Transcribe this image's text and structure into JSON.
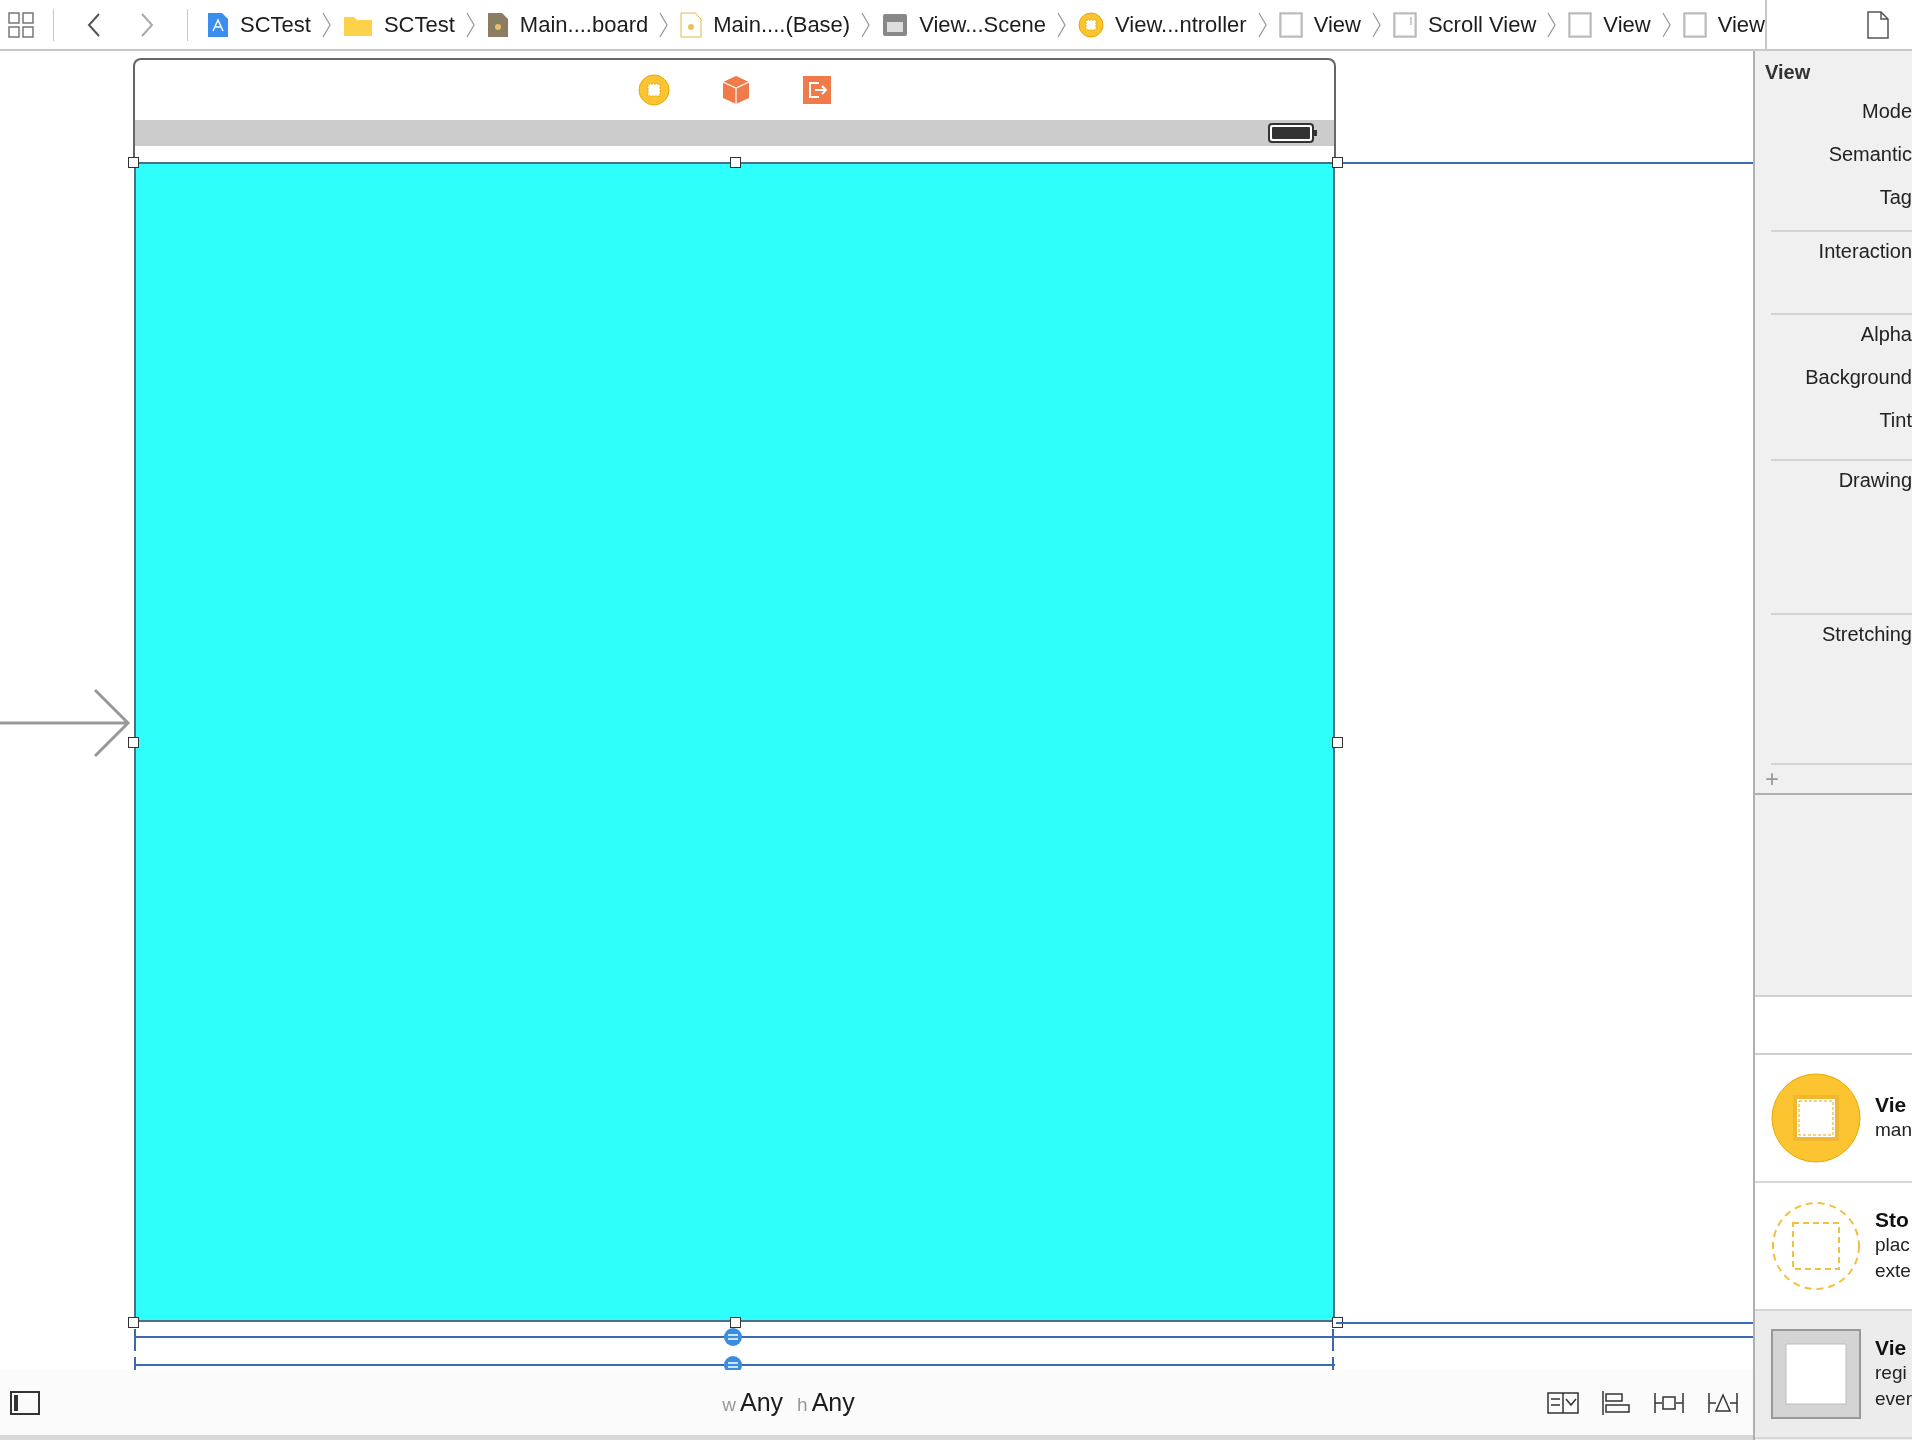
{
  "breadcrumbs": [
    {
      "kind": "app",
      "label": "SCTest"
    },
    {
      "kind": "folder",
      "label": "SCTest"
    },
    {
      "kind": "storyboard",
      "label": "Main....board"
    },
    {
      "kind": "file",
      "label": "Main....(Base)"
    },
    {
      "kind": "scene",
      "label": "View...Scene"
    },
    {
      "kind": "controller",
      "label": "View...ntroller"
    },
    {
      "kind": "view",
      "label": "View"
    },
    {
      "kind": "scrollview",
      "label": "Scroll View"
    },
    {
      "kind": "view",
      "label": "View"
    },
    {
      "kind": "view",
      "label": "View"
    }
  ],
  "inspector": {
    "title": "View",
    "groups": [
      {
        "labels": [
          "Mode",
          "Semantic",
          "Tag"
        ]
      },
      {
        "labels": [
          "Interaction"
        ]
      },
      {
        "labels": [
          "Alpha",
          "Background",
          "Tint"
        ]
      },
      {
        "labels": [
          "Drawing"
        ]
      },
      {
        "labels": [
          "Stretching"
        ]
      }
    ],
    "add": "+"
  },
  "library": [
    {
      "kind": "controller",
      "title": "Vie",
      "lines": [
        "man"
      ],
      "selected": false
    },
    {
      "kind": "reference",
      "title": "Sto",
      "lines": [
        "plac",
        "exte"
      ],
      "selected": false
    },
    {
      "kind": "view",
      "title": "Vie",
      "lines": [
        "regi",
        "ever"
      ],
      "selected": true
    }
  ],
  "size_class": {
    "w_label": "w",
    "w_value": "Any",
    "h_label": "h",
    "h_value": "Any"
  }
}
